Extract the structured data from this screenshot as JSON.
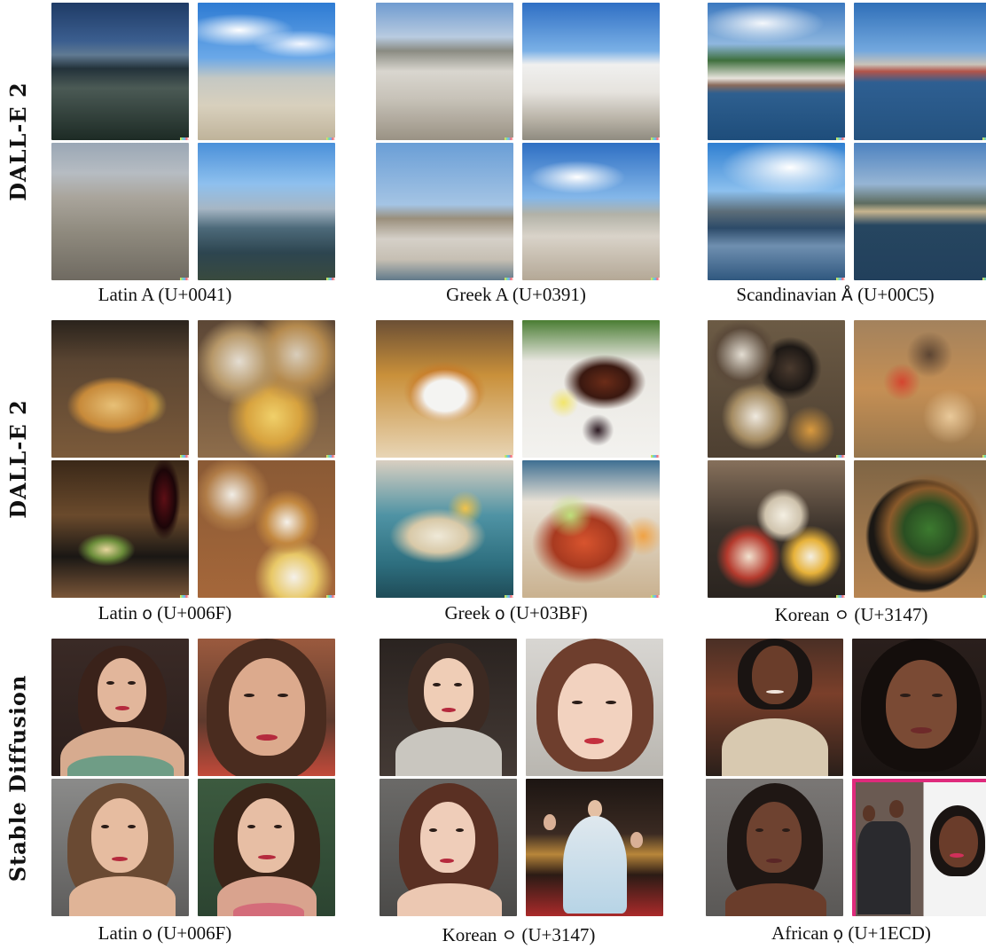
{
  "rows": [
    {
      "label": "DALL-E 2",
      "groups": [
        {
          "caption_prefix": "Latin A",
          "glyph": "",
          "code": "(U+0041)"
        },
        {
          "caption_prefix": "Greek A",
          "glyph": "",
          "code": "(U+0391)"
        },
        {
          "caption_prefix": "Scandinavian",
          "glyph": "Å",
          "code": "(U+00C5)"
        }
      ]
    },
    {
      "label": "DALL-E 2",
      "groups": [
        {
          "caption_prefix": "Latin",
          "glyph": "o",
          "code": "(U+006F)"
        },
        {
          "caption_prefix": "Greek",
          "glyph": "ο",
          "code": "(U+03BF)"
        },
        {
          "caption_prefix": "Korean",
          "glyph": "ㅇ",
          "code": "(U+3147)"
        }
      ]
    },
    {
      "label": "Stable Diffusion",
      "groups": [
        {
          "caption_prefix": "Latin",
          "glyph": "o",
          "code": "(U+006F)"
        },
        {
          "caption_prefix": "Korean",
          "glyph": "ㅇ",
          "code": "(U+3147)"
        },
        {
          "caption_prefix": "African",
          "glyph": "ọ",
          "code": "(U+1ECD)"
        }
      ]
    }
  ]
}
